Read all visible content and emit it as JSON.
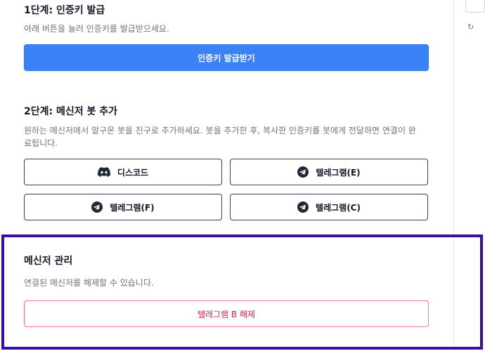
{
  "step1": {
    "title": "1단계: 인증키 발급",
    "desc": "아래 버튼을 눌러 인증키를 발급받으세요.",
    "button": "인증키 발급받기"
  },
  "step2": {
    "title": "2단계: 메신저 봇 추가",
    "desc_line1": "원하는 메신저에서 알구몬 봇을 친구로 추가하세요. 봇을 추가한 후, 복사한 인증키를 봇에게 전달하면 연결이 완",
    "desc_line2": "료됩니다.",
    "buttons": [
      {
        "label": "디스코드",
        "icon": "discord-icon"
      },
      {
        "label": "텔레그램(E)",
        "icon": "telegram-icon"
      },
      {
        "label": "텔레그램(F)",
        "icon": "telegram-icon"
      },
      {
        "label": "텔레그램(C)",
        "icon": "telegram-icon"
      }
    ]
  },
  "manage": {
    "title": "메신저 관리",
    "desc": "연결된 메신저를 해제할 수 있습니다.",
    "button": "텔레그램 B 해제"
  },
  "colors": {
    "primary": "#3b82f6",
    "danger": "#e11d48",
    "highlight_border": "#3a0ca3"
  }
}
